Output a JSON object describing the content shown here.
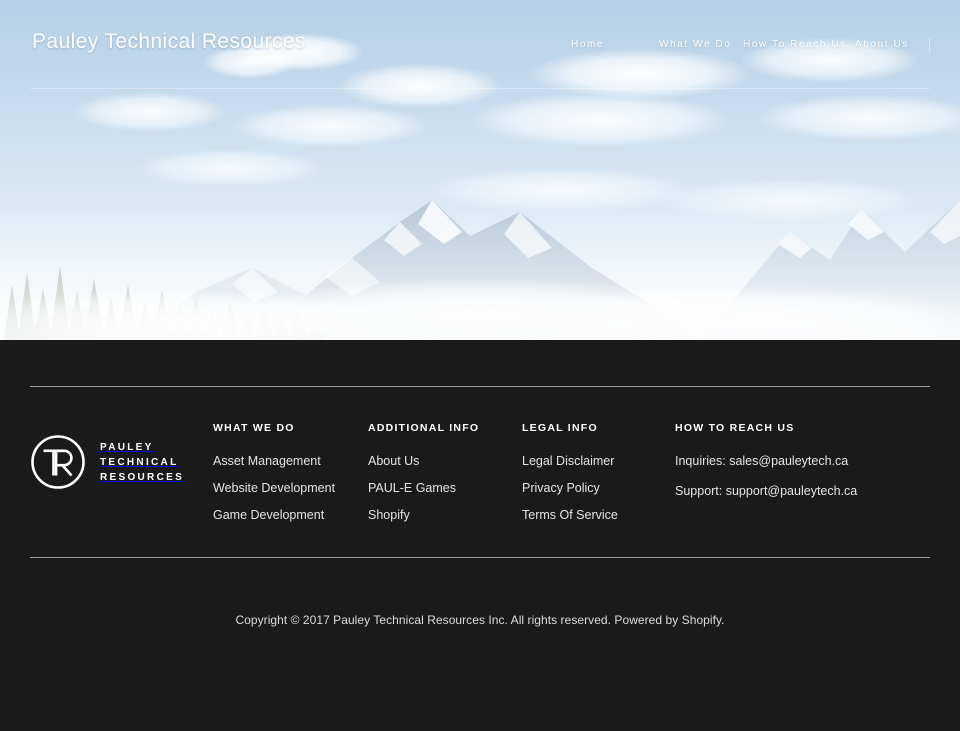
{
  "header": {
    "site_title": "Pauley Technical Resources",
    "nav": [
      {
        "label": "Home",
        "name": "nav-home"
      },
      {
        "label": "What We Do",
        "name": "nav-what-we-do"
      },
      {
        "label": "How To Reach Us",
        "name": "nav-how-to-reach-us"
      },
      {
        "label": "About Us",
        "name": "nav-about-us"
      }
    ]
  },
  "hero": {
    "alt": "snow-capped mountain range under a cloudy blue sky",
    "sky_color": "#a8c8e3",
    "cloud_color": "#ffffff"
  },
  "footer": {
    "background": "#1a1a1a",
    "logo": {
      "monogram": "TR",
      "line1": "PAULEY",
      "line2": "TECHNICAL",
      "line3": "RESOURCES"
    },
    "columns": [
      {
        "heading": "WHAT WE DO",
        "links": [
          "Asset Management",
          "Website Development",
          "Game Development"
        ]
      },
      {
        "heading": "ADDITIONAL INFO",
        "links": [
          "About Us",
          "PAUL-E Games",
          "Shopify"
        ]
      },
      {
        "heading": "LEGAL INFO",
        "links": [
          "Legal Disclaimer",
          "Privacy Policy",
          "Terms Of Service"
        ]
      },
      {
        "heading": "HOW TO REACH US",
        "links": [
          "Inquiries: sales@pauleytech.ca",
          "Support: support@pauleytech.ca"
        ]
      }
    ],
    "copyright": "Copyright © 2017 Pauley Technical Resources Inc. All rights reserved. Powered by Shopify."
  }
}
